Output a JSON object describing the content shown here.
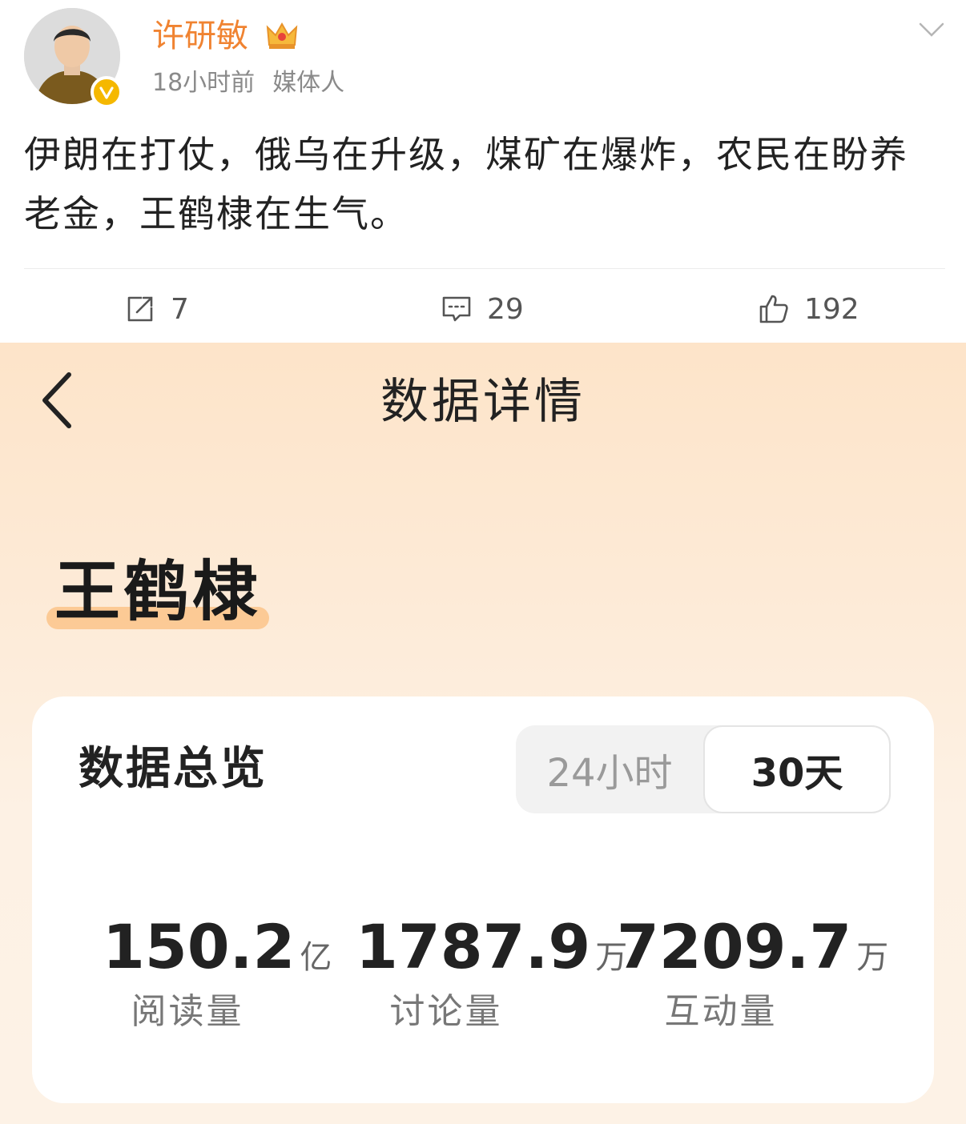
{
  "post": {
    "author": "许研敏",
    "time": "18小时前",
    "role": "媒体人",
    "text": "伊朗在打仗，俄乌在升级，煤矿在爆炸，农民在盼养老金，王鹤棣在生气。",
    "actions": {
      "repost_count": "7",
      "comment_count": "29",
      "like_count": "192"
    }
  },
  "detail": {
    "title": "数据详情",
    "topic": "王鹤棣",
    "overview": {
      "title": "数据总览",
      "tabs": [
        "24小时",
        "30天"
      ],
      "selected_tab": "30天",
      "stats": [
        {
          "value": "150.2",
          "unit": "亿",
          "label": "阅读量"
        },
        {
          "value": "1787.9",
          "unit": "万",
          "label": "讨论量"
        },
        {
          "value": "7209.7",
          "unit": "万",
          "label": "互动量"
        }
      ]
    }
  },
  "icons": {
    "crown": "crown-icon",
    "verify": "verified-badge-icon",
    "menu": "chevron-down-icon",
    "repost": "repost-icon",
    "comment": "comment-icon",
    "like": "thumbs-up-icon",
    "back": "back-arrow-icon"
  },
  "colors": {
    "author_name": "#f08331",
    "verify_badge": "#f5b800",
    "topic_highlight": "#fbc48a",
    "detail_background": "#fde4c9"
  }
}
